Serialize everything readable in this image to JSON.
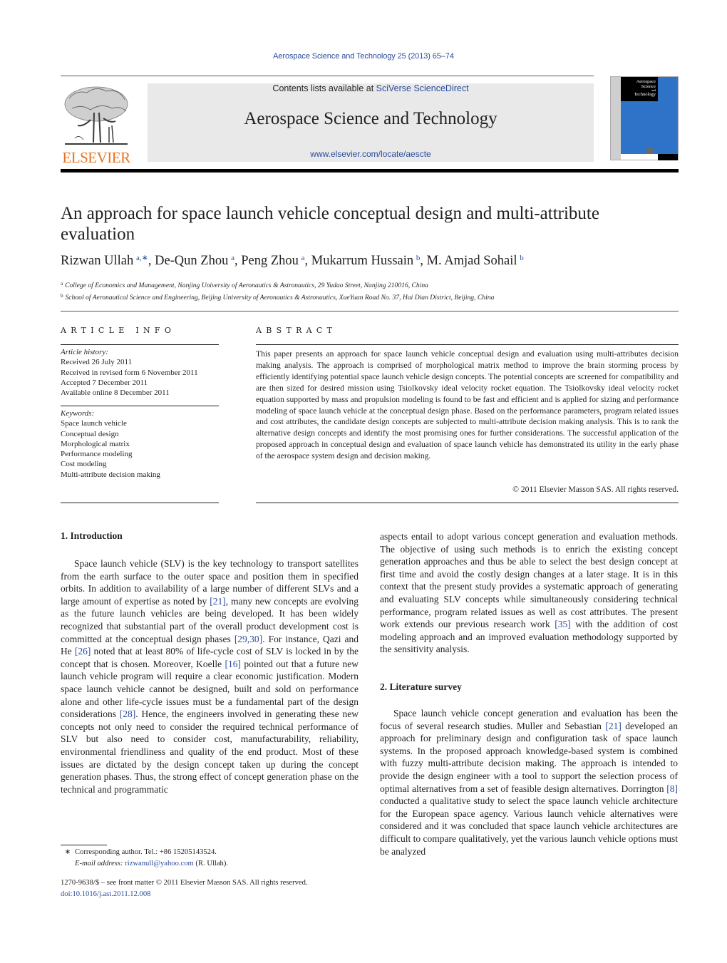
{
  "header": {
    "journal_citation": "Aerospace Science and Technology 25 (2013) 65–74",
    "contents_prefix": "Contents lists available at ",
    "contents_link": "SciVerse ScienceDirect",
    "journal_title": "Aerospace Science and Technology",
    "journal_url": "www.elsevier.com/locate/aescte",
    "publisher_logo_text": "ELSEVIER",
    "cover_text": [
      "Aerospace",
      "Science",
      "and",
      "Technology"
    ]
  },
  "colors": {
    "link": "#2a4b9b",
    "elsevier_orange": "#e9711c",
    "cover_blue": "#2f73c8",
    "masthead_gray": "#e9e9e9"
  },
  "article": {
    "title": "An approach for space launch vehicle conceptual design and multi-attribute evaluation",
    "authors": [
      {
        "name": "Rizwan Ullah",
        "sup": "a,∗",
        "sep": ", "
      },
      {
        "name": "De-Qun Zhou",
        "sup": "a",
        "sep": ", "
      },
      {
        "name": "Peng Zhou",
        "sup": "a",
        "sep": ", "
      },
      {
        "name": "Mukarrum Hussain",
        "sup": "b",
        "sep": ", "
      },
      {
        "name": "M. Amjad Sohail",
        "sup": "b",
        "sep": ""
      }
    ],
    "affiliations": [
      {
        "mark": "a",
        "text": "College of Economics and Management, Nanjing University of Aeronautics & Astronautics, 29 Yudao Street, Nanjing 210016, China"
      },
      {
        "mark": "b",
        "text": "School of Aeronautical Science and Engineering, Beijing University of Aeronautics & Astronautics, XueYuan Road No. 37, Hai Dian District, Beijing, China"
      }
    ]
  },
  "article_info": {
    "heading": "ARTICLE INFO",
    "history_label": "Article history:",
    "history": [
      "Received 26 July 2011",
      "Received in revised form 6 November 2011",
      "Accepted 7 December 2011",
      "Available online 8 December 2011"
    ],
    "keywords_label": "Keywords:",
    "keywords": [
      "Space launch vehicle",
      "Conceptual design",
      "Morphological matrix",
      "Performance modeling",
      "Cost modeling",
      "Multi-attribute decision making"
    ]
  },
  "abstract": {
    "heading": "ABSTRACT",
    "text": "This paper presents an approach for space launch vehicle conceptual design and evaluation using multi-attributes decision making analysis. The approach is comprised of morphological matrix method to improve the brain storming process by efficiently identifying potential space launch vehicle design concepts. The potential concepts are screened for compatibility and are then sized for desired mission using Tsiolkovsky ideal velocity rocket equation. The Tsiolkovsky ideal velocity rocket equation supported by mass and propulsion modeling is found to be fast and efficient and is applied for sizing and performance modeling of space launch vehicle at the conceptual design phase. Based on the performance parameters, program related issues and cost attributes, the candidate design concepts are subjected to multi-attribute decision making analysis. This is to rank the alternative design concepts and identify the most promising ones for further considerations. The successful application of the proposed approach in conceptual design and evaluation of space launch vehicle has demonstrated its utility in the early phase of the aerospace system design and decision making.",
    "copyright": "© 2011 Elsevier Masson SAS. All rights reserved."
  },
  "body": {
    "intro_heading": "1. Introduction",
    "intro_p1": [
      {
        "t": "Space launch vehicle (SLV) is the key technology to transport satellites from the earth surface to the outer space and position them in specified orbits. In addition to availability of a large number of different SLVs and a large amount of expertise as noted by "
      },
      {
        "ref": "[21]"
      },
      {
        "t": ", many new concepts are evolving as the future launch vehicles are being developed. It has been widely recognized that substantial part of the overall product development cost is committed at the conceptual design phases "
      },
      {
        "ref": "[29,30]"
      },
      {
        "t": ". For instance, Qazi and He "
      },
      {
        "ref": "[26]"
      },
      {
        "t": " noted that at least 80% of life-cycle cost of SLV is locked in by the concept that is chosen. Moreover, Koelle "
      },
      {
        "ref": "[16]"
      },
      {
        "t": " pointed out that a future new launch vehicle program will require a clear economic justification. Modern space launch vehicle cannot be designed, built and sold on performance alone and other life-cycle issues must be a fundamental part of the design considerations "
      },
      {
        "ref": "[28]"
      },
      {
        "t": ". Hence, the engineers involved in generating these new concepts not only need to consider the required technical performance of SLV but also need to consider cost, manufacturability, reliability, environmental friendliness and quality of the end product. Most of these issues are dictated by the design concept taken up during the concept generation phases. Thus, the strong effect of concept generation phase on the technical and programmatic"
      }
    ],
    "intro_p1_cont": [
      {
        "t": "aspects entail to adopt various concept generation and evaluation methods. The objective of using such methods is to enrich the existing concept generation approaches and thus be able to select the best design concept at first time and avoid the costly design changes at a later stage. It is in this context that the present study provides a systematic approach of generating and evaluating SLV concepts while simultaneously considering technical performance, program related issues as well as cost attributes. The present work extends our previous research work "
      },
      {
        "ref": "[35]"
      },
      {
        "t": " with the addition of cost modeling approach and an improved evaluation methodology supported by the sensitivity analysis."
      }
    ],
    "lit_heading": "2. Literature survey",
    "lit_p1": [
      {
        "t": "Space launch vehicle concept generation and evaluation has been the focus of several research studies. Muller and Sebastian "
      },
      {
        "ref": "[21]"
      },
      {
        "t": " developed an approach for preliminary design and configuration task of space launch systems. In the proposed approach knowledge-based system is combined with fuzzy multi-attribute decision making. The approach is intended to provide the design engineer with a tool to support the selection process of optimal alternatives from a set of feasible design alternatives. Dorrington "
      },
      {
        "ref": "[8]"
      },
      {
        "t": " conducted a qualitative study to select the space launch vehicle architecture for the European space agency. Various launch vehicle alternatives were considered and it was concluded that space launch vehicle architectures are difficult to compare qualitatively, yet the various launch vehicle options must be analyzed"
      }
    ]
  },
  "footnotes": {
    "star": "∗",
    "corresponding": "Corresponding author. Tel.: +86 15205143524.",
    "email_label": "E-mail address:",
    "email": "rizwanull@yahoo.com",
    "email_suffix": " (R. Ullah).",
    "issn_line": "1270-9638/$ – see front matter  © 2011 Elsevier Masson SAS. All rights reserved.",
    "doi": "doi:10.1016/j.ast.2011.12.008"
  }
}
